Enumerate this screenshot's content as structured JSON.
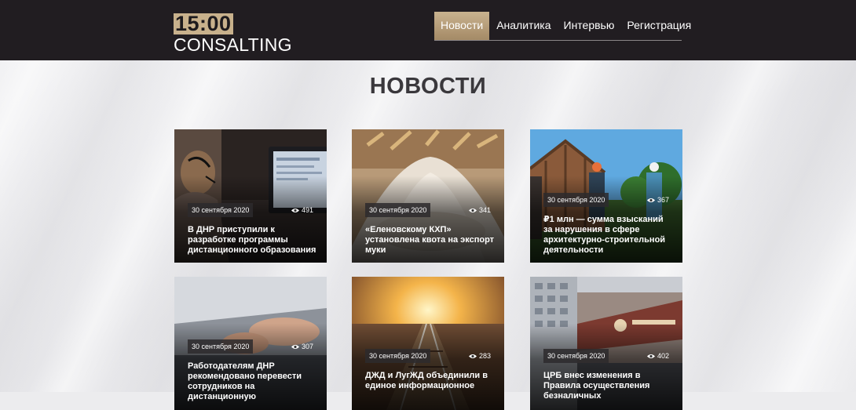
{
  "header": {
    "logo_time": "15:00",
    "logo_brand": "CONSALTING",
    "nav": [
      {
        "label": "Новости",
        "active": true
      },
      {
        "label": "Аналитика",
        "active": false
      },
      {
        "label": "Интервью",
        "active": false
      },
      {
        "label": "Регистрация",
        "active": false
      }
    ]
  },
  "main": {
    "title": "НОВОСТИ",
    "cards": [
      {
        "date": "30 сентября 2020",
        "views": "491",
        "title": "В ДНР приступили к разработке программы дистанционного образования"
      },
      {
        "date": "30 сентября 2020",
        "views": "341",
        "title": "«Еленовскому КХП» установлена квота на экспорт муки"
      },
      {
        "date": "30 сентября 2020",
        "views": "367",
        "title": "₽1 млн — сумма взысканий за нарушения в сфере архитектурно-строительной деятельности"
      },
      {
        "date": "30 сентября 2020",
        "views": "307",
        "title": "Работодателям ДНР рекомендовано перевести сотрудников на дистанционную"
      },
      {
        "date": "30 сентября 2020",
        "views": "283",
        "title": "ДЖД и ЛугЖД объединили в единое информационное"
      },
      {
        "date": "30 сентября 2020",
        "views": "402",
        "title": "ЦРБ внес изменения в Правила осуществления безналичных"
      }
    ]
  },
  "colors": {
    "header_bg": "#211d21",
    "accent_gold": "#c8b18c",
    "page_bg": "#ececee",
    "title_color": "#3a383c"
  }
}
